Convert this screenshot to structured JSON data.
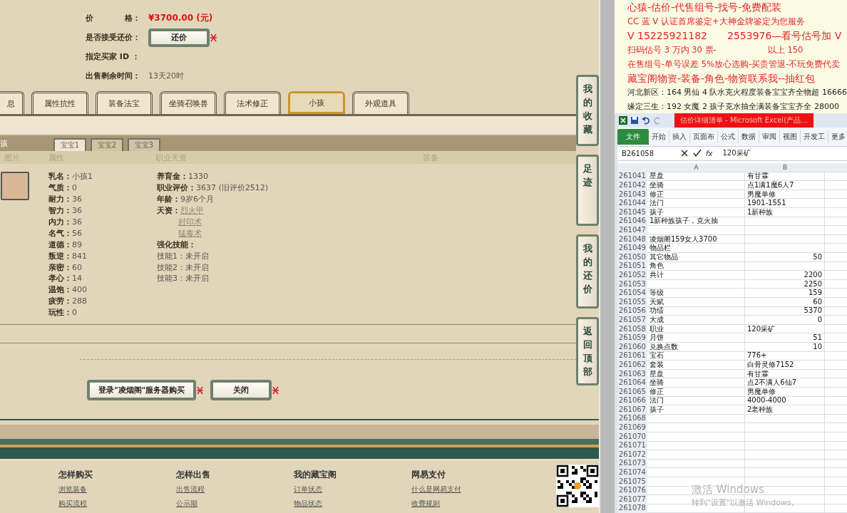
{
  "listing": {
    "fields": [
      {
        "label": "价　　　　格：",
        "value": "¥3700.00 (元)",
        "kind": "price"
      },
      {
        "label": "是否接受还价：",
        "value": "还价",
        "kind": "button"
      },
      {
        "label": "指定买家 ID ：",
        "kind": "text"
      },
      {
        "label": "出售剩余时间：",
        "value": "13天20时",
        "kind": "text"
      }
    ],
    "tabs": [
      {
        "label": "息",
        "selected": false
      },
      {
        "label": "属性抗性",
        "selected": false
      },
      {
        "label": "装备法宝",
        "selected": false
      },
      {
        "label": "坐骑召唤兽",
        "selected": false
      },
      {
        "label": "法术修正",
        "selected": false
      },
      {
        "label": "小孩",
        "selected": true
      },
      {
        "label": "外观道具",
        "selected": false
      }
    ],
    "section_title": "孩",
    "subtabs": [
      {
        "label": "宝宝1",
        "selected": true
      },
      {
        "label": "宝宝2",
        "selected": false
      },
      {
        "label": "宝宝3",
        "selected": false
      }
    ],
    "columns": [
      "图片",
      "属性",
      "职业天资",
      "装备"
    ],
    "attributes": [
      {
        "name": "乳名：",
        "value": "小孩1"
      },
      {
        "name": "气质：",
        "value": "0"
      },
      {
        "name": "耐力：",
        "value": "36"
      },
      {
        "name": "智力：",
        "value": "36"
      },
      {
        "name": "内力：",
        "value": "36"
      },
      {
        "name": "名气：",
        "value": "56"
      },
      {
        "name": "道德：",
        "value": "89"
      },
      {
        "name": "叛逆：",
        "value": "841"
      },
      {
        "name": "亲密：",
        "value": "60"
      },
      {
        "name": "孝心：",
        "value": "14"
      },
      {
        "name": "温饱：",
        "value": "400"
      },
      {
        "name": "疲劳：",
        "value": "288"
      },
      {
        "name": "玩性：",
        "value": "0"
      }
    ],
    "career": [
      {
        "name": "养育金：",
        "value": "1330"
      },
      {
        "name": "职业评价：",
        "value": "3637 (旧评价2512)"
      },
      {
        "name": "年龄：",
        "value": "9岁6个月"
      }
    ],
    "talent_label": "天资：",
    "talents": [
      "烈火甲",
      "封印术",
      "猛毒术"
    ],
    "skills_title": "强化技能：",
    "skills": [
      {
        "name": "技能1：",
        "value": "未开启"
      },
      {
        "name": "技能2：",
        "value": "未开启"
      },
      {
        "name": "技能3：",
        "value": "未开启"
      }
    ],
    "actions": [
      "登录\"凌烟阁\"服务器购买",
      "关闭"
    ],
    "side_nav": [
      "我的收藏",
      "足迹",
      "我的还价",
      "返回顶部"
    ],
    "footer": [
      {
        "title": "怎样购买",
        "links": [
          "浏览装备",
          "购买流程"
        ]
      },
      {
        "title": "怎样出售",
        "links": [
          "出售流程",
          "公示期"
        ]
      },
      {
        "title": "我的藏宝阁",
        "links": [
          "订单状态",
          "物品状态"
        ]
      },
      {
        "title": "网易支付",
        "links": [
          "什么是网易支付",
          "收费规则"
        ]
      }
    ]
  },
  "document": {
    "lines": [
      {
        "text": "心猿-估价-代售组号-找号-免费配装",
        "kind": "heading"
      },
      {
        "text": "CC 蓝 V 认证首席鉴定+大神金牌鉴定为您服务",
        "kind": "red"
      },
      {
        "text": "V 15225921182　　2553976—看号估号加 V",
        "kind": "heading"
      },
      {
        "text": "扫码估号 3 万内 30 票-　　　　　　以上 150",
        "kind": "red"
      },
      {
        "text": "在售组号-单号误差 5%放心选购-买贵管退-不玩免费代卖",
        "kind": "red"
      },
      {
        "text": "藏宝阁物资-装备-角色-物资联系我--抽红包",
        "kind": "heading"
      },
      {
        "text": "河北新区：164 男仙 4 队水克火程度装备宝宝齐全物超 16666",
        "kind": "black"
      },
      {
        "text": "缘定三生：192 女魔 2 孩子克水抽全满装备宝宝齐全 28000",
        "kind": "black"
      }
    ]
  },
  "excel": {
    "title": "估价详细清单 - Microsoft Excel(产品...",
    "ribbon_tabs": [
      {
        "label": "文件",
        "kind": "file"
      },
      {
        "label": "开始",
        "kind": "tab"
      },
      {
        "label": "插入",
        "kind": "tab"
      },
      {
        "label": "页面布",
        "kind": "tab"
      },
      {
        "label": "公式",
        "kind": "tab"
      },
      {
        "label": "数据",
        "kind": "tab"
      },
      {
        "label": "审阅",
        "kind": "tab"
      },
      {
        "label": "视图",
        "kind": "tab"
      },
      {
        "label": "开发工",
        "kind": "tab"
      },
      {
        "label": "更多",
        "kind": "tab"
      }
    ],
    "name_box": "B261058",
    "function_label": "fx",
    "formula": "120采矿",
    "columns": [
      "A",
      "B"
    ],
    "rows": [
      {
        "number": "261041",
        "a": "星盘",
        "b": "有甘霖",
        "b_numeric": false
      },
      {
        "number": "261042",
        "a": "坐骑",
        "b": "点1满1魔6人7",
        "b_numeric": false
      },
      {
        "number": "261043",
        "a": "修正",
        "b": "男魔单修",
        "b_numeric": false
      },
      {
        "number": "261044",
        "a": "法门",
        "b": "1901-1551",
        "b_numeric": false
      },
      {
        "number": "261045",
        "a": "孩子",
        "b": "1新种族",
        "b_numeric": false
      },
      {
        "number": "261046",
        "a": "1新种族孩子，克火抽"
      },
      {
        "number": "261047"
      },
      {
        "number": "261048",
        "a": "凌烟阁159女人3700"
      },
      {
        "number": "261049",
        "a": "物品栏"
      },
      {
        "number": "261050",
        "a": "其它物品",
        "b": "50",
        "b_numeric": true
      },
      {
        "number": "261051",
        "a": "角色"
      },
      {
        "number": "261052",
        "a": "共计",
        "b": "2200",
        "b_numeric": true
      },
      {
        "number": "261053",
        "b": "2250",
        "b_numeric": true
      },
      {
        "number": "261054",
        "a": "等级",
        "b": "159",
        "b_numeric": true
      },
      {
        "number": "261055",
        "a": "天赋",
        "b": "60",
        "b_numeric": true
      },
      {
        "number": "261056",
        "a": "功绩",
        "b": "5370",
        "b_numeric": true
      },
      {
        "number": "261057",
        "a": "大成",
        "b": "0",
        "b_numeric": true
      },
      {
        "number": "261058",
        "a": "职业",
        "b": "120采矿",
        "b_numeric": false
      },
      {
        "number": "261059",
        "a": "月饼",
        "b": "51",
        "b_numeric": true
      },
      {
        "number": "261060",
        "a": "兑换点数",
        "b": "10",
        "b_numeric": true
      },
      {
        "number": "261061",
        "a": "宝石",
        "b": "776+",
        "b_numeric": false
      },
      {
        "number": "261062",
        "a": "套装",
        "b": "白骨灵修7152",
        "b_numeric": false
      },
      {
        "number": "261063",
        "a": "星盘",
        "b": "有甘霖",
        "b_numeric": false
      },
      {
        "number": "261064",
        "a": "坐骑",
        "b": "点2不满人6仙7",
        "b_numeric": false
      },
      {
        "number": "261065",
        "a": "修正",
        "b": "男魔单修",
        "b_numeric": false
      },
      {
        "number": "261066",
        "a": "法门",
        "b": "4000-4000",
        "b_numeric": false
      },
      {
        "number": "261067",
        "a": "孩子",
        "b": "2老种族",
        "b_numeric": false
      },
      {
        "number": "261068"
      },
      {
        "number": "261069"
      },
      {
        "number": "261070"
      },
      {
        "number": "261071"
      },
      {
        "number": "261072"
      },
      {
        "number": "261073"
      },
      {
        "number": "261074"
      },
      {
        "number": "261075"
      },
      {
        "number": "261076"
      },
      {
        "number": "261077"
      },
      {
        "number": "261078"
      }
    ]
  },
  "windows_notice": [
    "激活 Windows",
    "转到\"设置\"以激活 Windows。"
  ]
}
